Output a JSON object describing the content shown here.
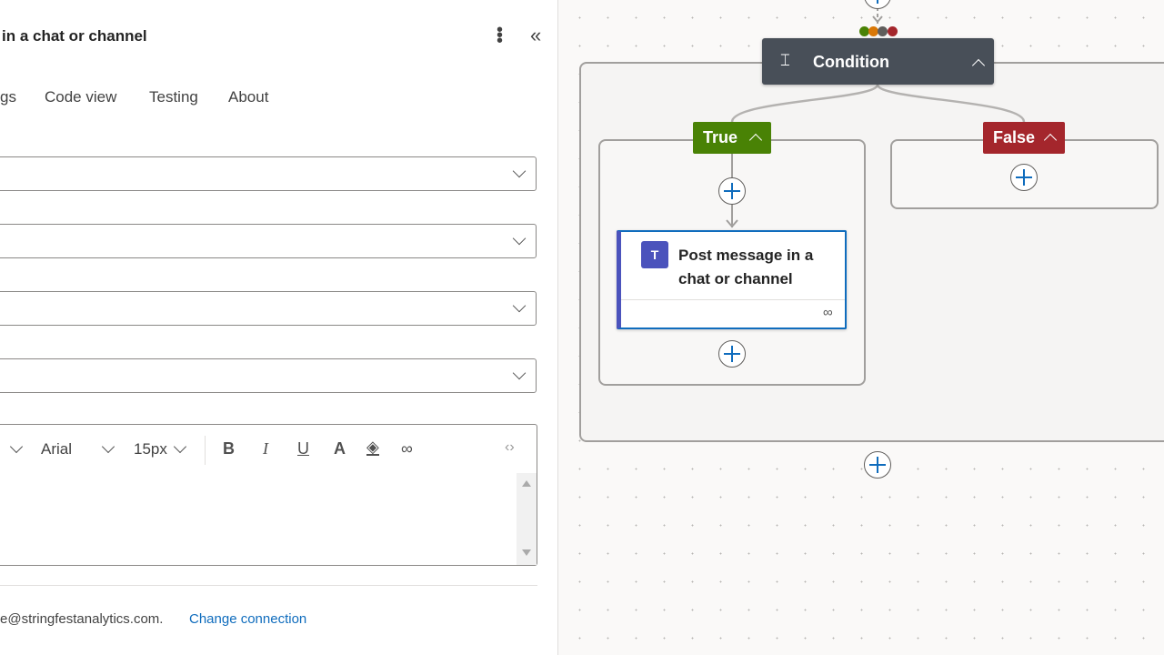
{
  "panel": {
    "title": "in a chat or channel",
    "tabs": [
      "gs",
      "Code view",
      "Testing",
      "About"
    ],
    "editor": {
      "font": "Arial",
      "size": "15px",
      "bold": "B",
      "italic": "I",
      "underline": "U",
      "font_color": "A"
    },
    "footer": {
      "connection_text": "e@stringfestanalytics.com.",
      "change_connection": "Change connection"
    }
  },
  "canvas": {
    "condition": {
      "label": "Condition"
    },
    "true_branch": {
      "label": "True",
      "color": "#498205"
    },
    "false_branch": {
      "label": "False",
      "color": "#a4262c"
    },
    "action": {
      "label_line1": "Post message in a",
      "label_line2": "chat or channel"
    },
    "status_dots": [
      "#498205",
      "#d97706",
      "#605e5c",
      "#a4262c"
    ]
  }
}
